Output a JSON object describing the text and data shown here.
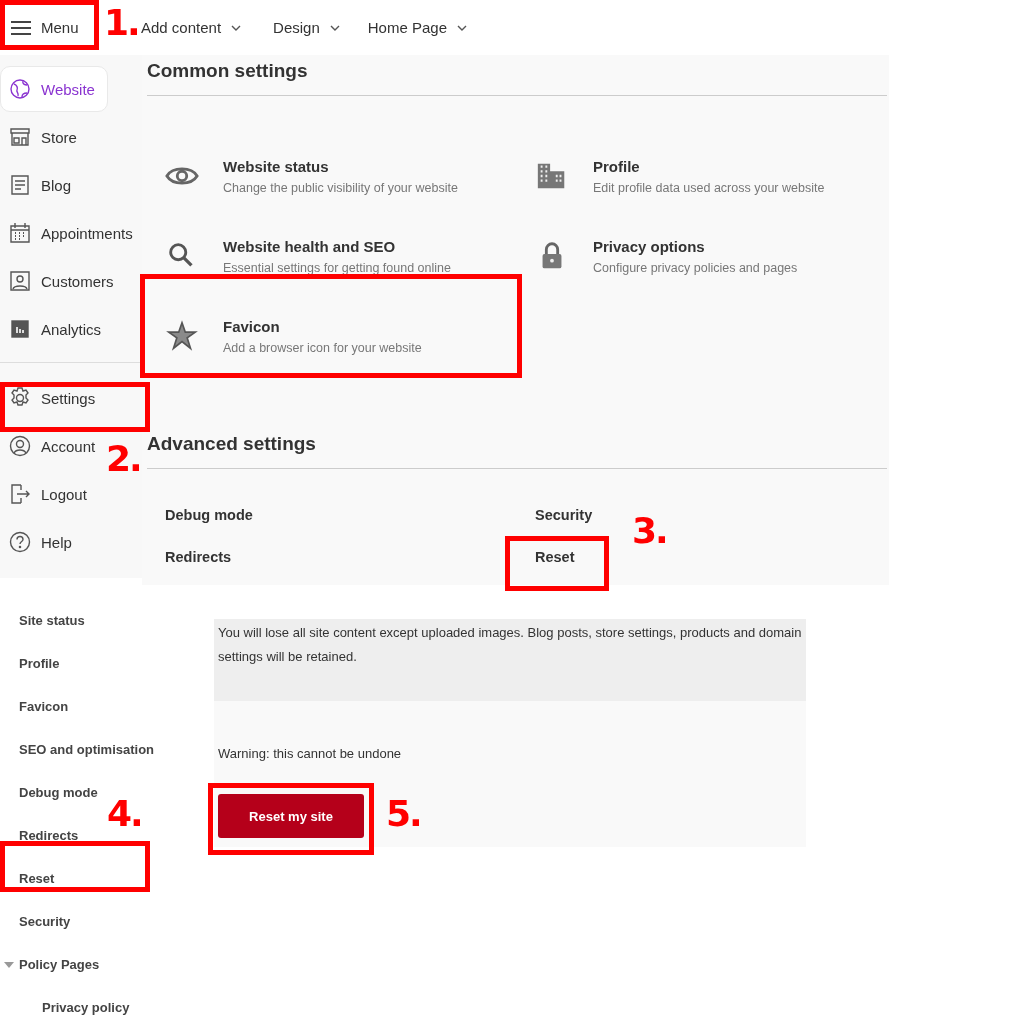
{
  "top_bar": {
    "menu_button": "Menu",
    "nav": [
      {
        "label": "Add content"
      },
      {
        "label": "Design"
      },
      {
        "label": "Home Page"
      }
    ]
  },
  "sidebar": {
    "items": [
      {
        "label": "Website",
        "selected": true
      },
      {
        "label": "Store",
        "selected": false
      },
      {
        "label": "Blog",
        "selected": false
      },
      {
        "label": "Appointments",
        "selected": false
      },
      {
        "label": "Customers",
        "selected": false
      },
      {
        "label": "Analytics",
        "selected": false
      }
    ],
    "bottom_items": [
      {
        "label": "Settings"
      },
      {
        "label": "Account"
      },
      {
        "label": "Logout"
      },
      {
        "label": "Help"
      }
    ]
  },
  "common_settings": {
    "title": "Common settings",
    "tiles": [
      {
        "title": "Website status",
        "description": "Change the public visibility of your website"
      },
      {
        "title": "Profile",
        "description": "Edit profile data used across your website"
      },
      {
        "title": "Website health and SEO",
        "description": "Essential settings for getting found online"
      },
      {
        "title": "Privacy options",
        "description": "Configure privacy policies and pages"
      },
      {
        "title": "Favicon",
        "description": "Add a browser icon for your website"
      }
    ]
  },
  "advanced_settings": {
    "title": "Advanced settings",
    "links": [
      "Debug mode",
      "Security",
      "Redirects",
      "Reset"
    ]
  },
  "settings_nav": {
    "items": [
      {
        "label": "Site status"
      },
      {
        "label": "Profile"
      },
      {
        "label": "Favicon"
      },
      {
        "label": "SEO and optimisation"
      },
      {
        "label": "Debug mode"
      },
      {
        "label": "Redirects"
      },
      {
        "label": "Reset"
      },
      {
        "label": "Security"
      },
      {
        "label": "Policy Pages",
        "expanded": true,
        "children": [
          {
            "label": "Privacy policy"
          }
        ]
      }
    ]
  },
  "reset_panel": {
    "notice": "You will lose all site content except uploaded images. Blog posts, store settings, products and domain settings will be retained.",
    "warning": "Warning: this cannot be undone",
    "button": "Reset my site"
  },
  "annotations": [
    {
      "number": "1."
    },
    {
      "number": "2."
    },
    {
      "number": "3."
    },
    {
      "number": "4."
    },
    {
      "number": "5."
    }
  ]
}
